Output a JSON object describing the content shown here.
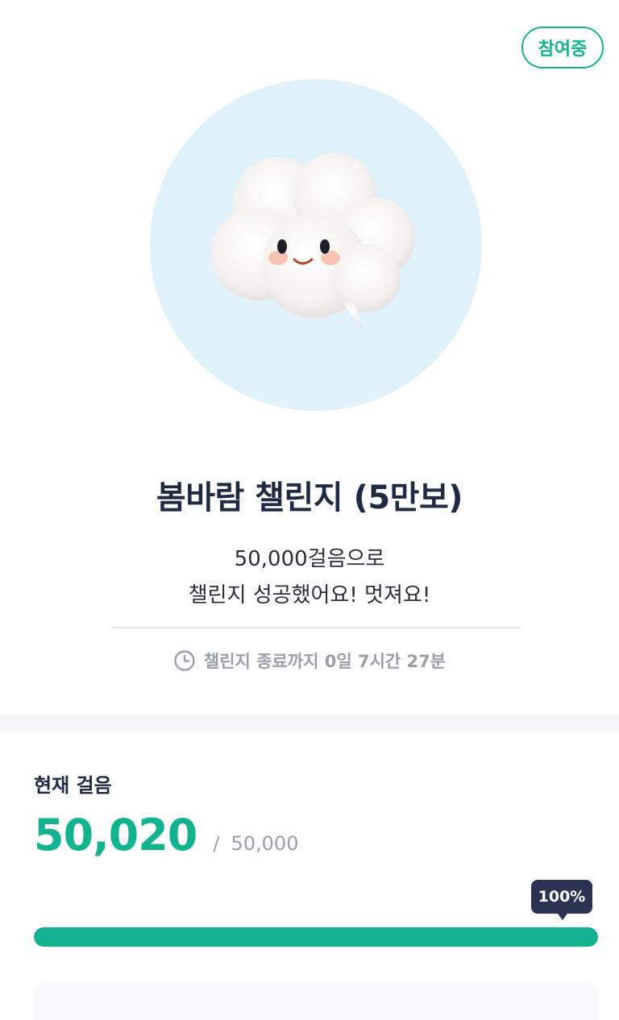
{
  "status_badge": "참여중",
  "challenge": {
    "title": "봄바람 챌린지 (5만보)",
    "desc_line1": "50,000걸음으로",
    "desc_line2": "챌린지 성공했어요! 멋져요!",
    "deadline": "챌린지 종료까지 0일 7시간 27분"
  },
  "steps": {
    "label": "현재 걸음",
    "current": "50,020",
    "separator": "/",
    "goal": "50,000",
    "percent_label": "100%",
    "progress": 1.0
  },
  "colors": {
    "accent": "#14b38f",
    "title": "#1f2a44",
    "hero_bg": "#dff2fc",
    "tooltip_bg": "#2a3352"
  },
  "icons": {
    "mascot": "cloud-character-icon",
    "deadline": "clock-icon"
  }
}
